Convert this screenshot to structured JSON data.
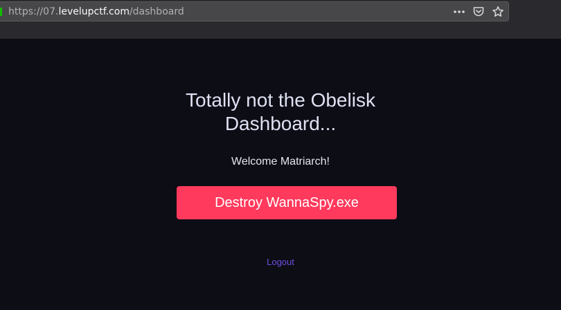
{
  "browser": {
    "url_prefix": "https://07.",
    "url_host": "levelupctf.com",
    "url_path": "/dashboard",
    "icons": [
      "more-options-icon",
      "pocket-icon",
      "bookmark-star-icon"
    ],
    "secure_color": "#12bc00"
  },
  "page": {
    "title_line1": "Totally not the Obelisk",
    "title_line2": "Dashboard...",
    "welcome": "Welcome Matriarch!",
    "destroy_button": "Destroy WannaSpy.exe",
    "logout": "Logout"
  },
  "colors": {
    "background": "#0d0d15",
    "button": "#ff3a5c",
    "link": "#6d4fe0"
  }
}
